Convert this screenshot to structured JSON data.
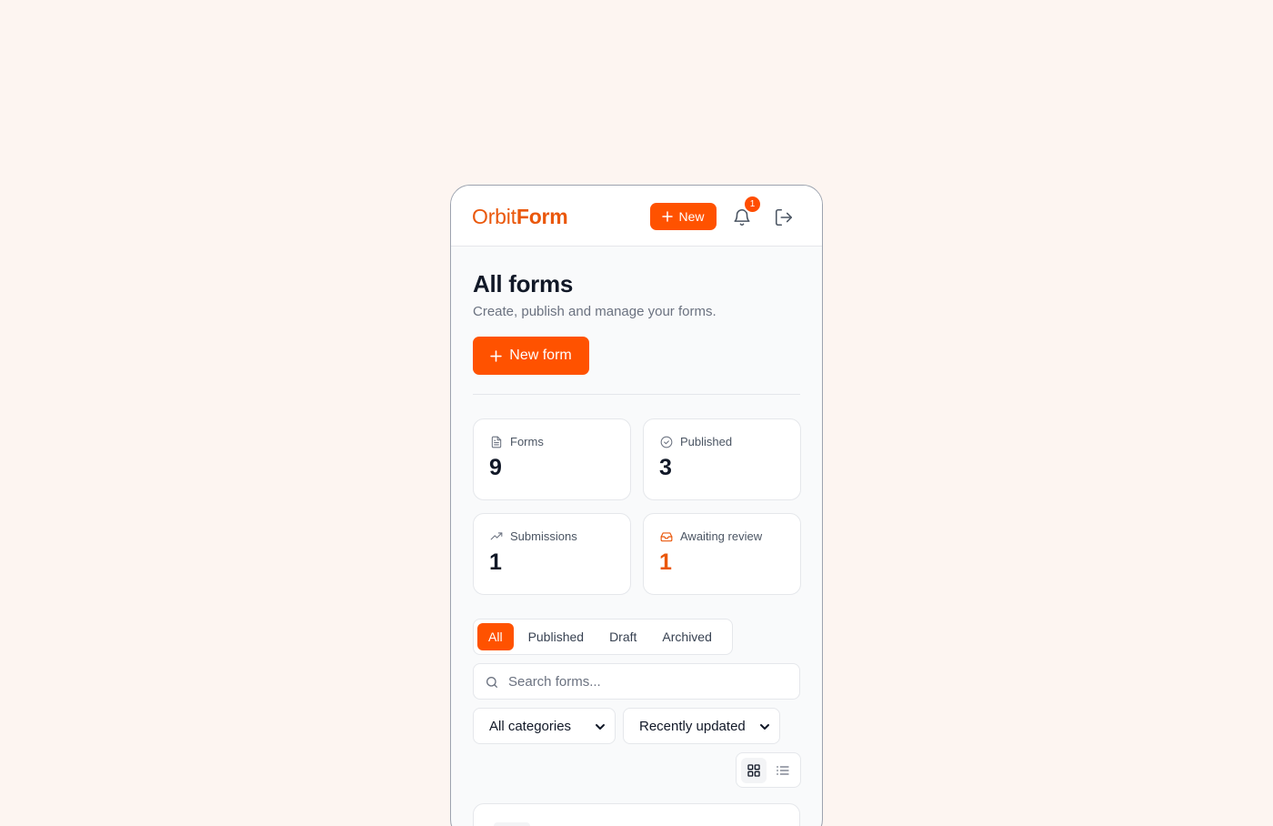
{
  "app": {
    "logo_part1": "Orbit",
    "logo_part2": "Form",
    "new_label": "New",
    "notifications_count": "1",
    "accent_color": "#ff5200"
  },
  "page": {
    "title": "All forms",
    "subtitle": "Create, publish and manage your forms.",
    "new_form_label": "New form"
  },
  "stats": [
    {
      "label": "Forms",
      "value": "9",
      "icon": "document-icon"
    },
    {
      "label": "Published",
      "value": "3",
      "icon": "check-circle-icon"
    },
    {
      "label": "Submissions",
      "value": "1",
      "icon": "trending-up-icon"
    },
    {
      "label": "Awaiting review",
      "value": "1",
      "icon": "inbox-icon"
    }
  ],
  "tabs": [
    {
      "label": "All",
      "active": true
    },
    {
      "label": "Published",
      "active": false
    },
    {
      "label": "Draft",
      "active": false
    },
    {
      "label": "Archived",
      "active": false
    }
  ],
  "search": {
    "placeholder": "Search forms..."
  },
  "filters": {
    "category": "All categories",
    "sort": "Recently updated"
  },
  "view": {
    "mode": "grid"
  }
}
